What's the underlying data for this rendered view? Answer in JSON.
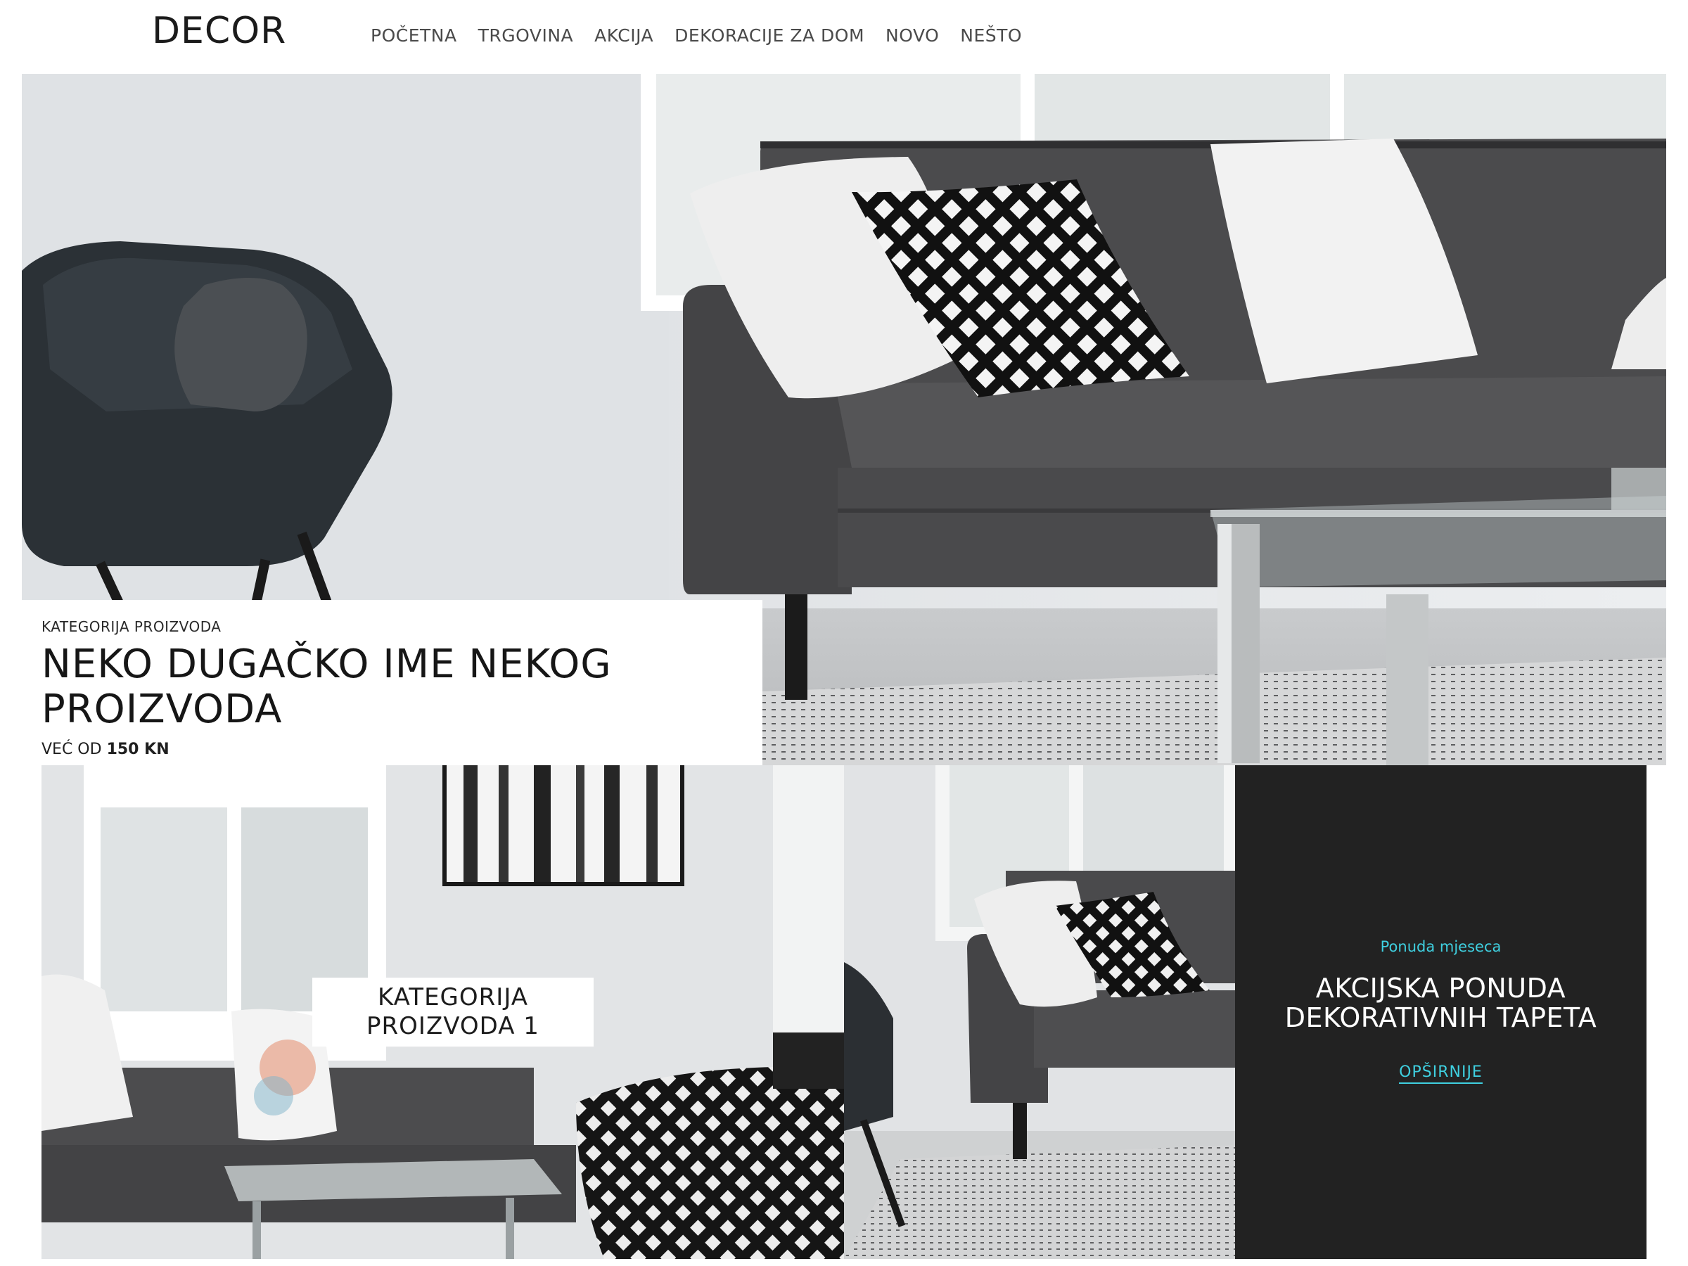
{
  "header": {
    "logo": "DECOR",
    "nav": [
      "POČETNA",
      "TRGOVINA",
      "AKCIJA",
      "DEKORACIJE ZA DOM",
      "NOVO",
      "NEŠTO"
    ]
  },
  "hero": {
    "category": "KATEGORIJA PROIZVODA",
    "title_line1": "NEKO DUGAČKO IME NEKOG",
    "title_line2": "PROIZVODA",
    "price_prefix": "VEĆ OD",
    "price_value": "150 KN"
  },
  "category_tile": {
    "label_line1": "KATEGORIJA",
    "label_line2": "PROIZVODA 1"
  },
  "promo": {
    "kicker": "Ponuda mjeseca",
    "title_line1": "AKCIJSKA PONUDA",
    "title_line2": "DEKORATIVNIH TAPETA",
    "link": "OPŠIRNIJE"
  },
  "colors": {
    "accent": "#3fd0e0",
    "promo_bg": "#222222",
    "sofa": "#4a4a4c"
  }
}
